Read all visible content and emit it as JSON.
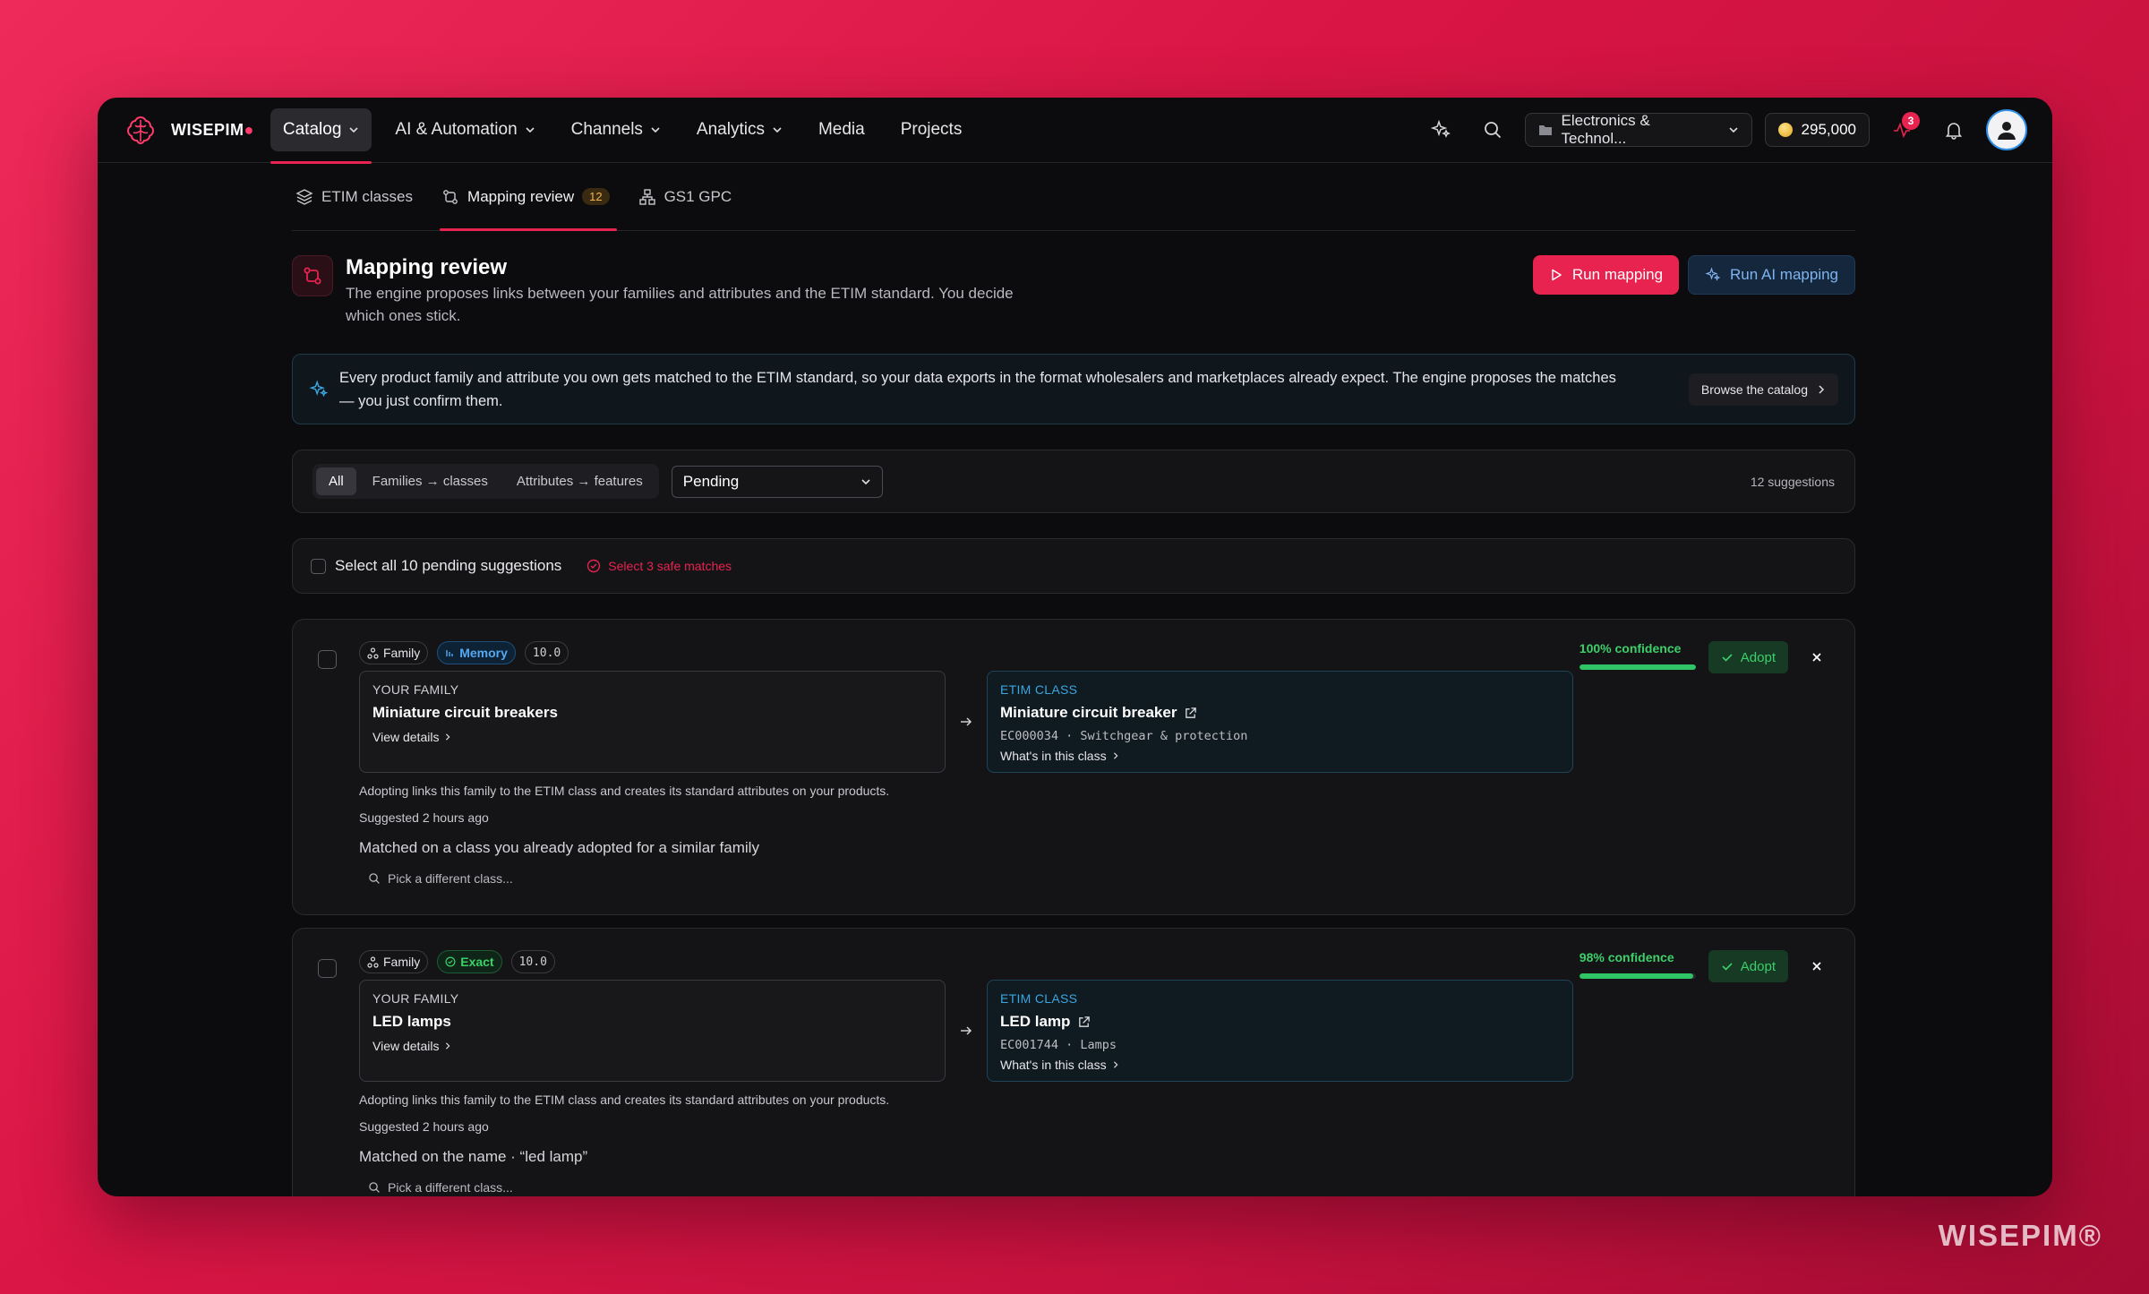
{
  "brand": {
    "name": "WISEPIM",
    "footer": "WISEPIM®"
  },
  "nav": {
    "items": [
      {
        "label": "Catalog"
      },
      {
        "label": "AI & Automation"
      },
      {
        "label": "Channels"
      },
      {
        "label": "Analytics"
      },
      {
        "label": "Media"
      },
      {
        "label": "Projects"
      }
    ],
    "workspace": "Electronics & Technol...",
    "credits": "295,000",
    "notification_count": "3"
  },
  "tabs": [
    {
      "label": "ETIM classes"
    },
    {
      "label": "Mapping review",
      "count": "12"
    },
    {
      "label": "GS1 GPC"
    }
  ],
  "header": {
    "title": "Mapping review",
    "description": "The engine proposes links between your families and attributes and the ETIM standard. You decide which ones stick.",
    "run_mapping": "Run mapping",
    "run_ai_mapping": "Run AI mapping"
  },
  "banner": {
    "text": "Every product family and attribute you own gets matched to the ETIM standard, so your data exports in the format wholesalers and marketplaces already expect. The engine proposes the matches — you just confirm them.",
    "button": "Browse the catalog"
  },
  "filters": {
    "segments": [
      "All",
      "Families → classes",
      "Attributes → features"
    ],
    "status_select": "Pending",
    "count": "12 suggestions"
  },
  "select_all": {
    "label": "Select all 10 pending suggestions",
    "safe": "Select 3 safe matches"
  },
  "cards": [
    {
      "type": "Family",
      "source_chip": "Memory",
      "score": "10.0",
      "family_label": "YOUR FAMILY",
      "family_name": "Miniature circuit breakers",
      "view_details": "View details",
      "etim_label": "ETIM CLASS",
      "etim_name": "Miniature circuit breaker",
      "etim_code": "EC000034 · Switchgear & protection",
      "whats_in": "What's in this class",
      "note": "Adopting links this family to the ETIM class and creates its standard attributes on your products.",
      "suggested": "Suggested 2 hours ago",
      "reason": "Matched on a class you already adopted for a similar family",
      "pick": "Pick a different class...",
      "confidence": "100% confidence",
      "confidence_value": 100,
      "adopt": "Adopt"
    },
    {
      "type": "Family",
      "source_chip": "Exact",
      "score": "10.0",
      "family_label": "YOUR FAMILY",
      "family_name": "LED lamps",
      "view_details": "View details",
      "etim_label": "ETIM CLASS",
      "etim_name": "LED lamp",
      "etim_code": "EC001744 · Lamps",
      "whats_in": "What's in this class",
      "note": "Adopting links this family to the ETIM class and creates its standard attributes on your products.",
      "suggested": "Suggested 2 hours ago",
      "reason": "Matched on the name · “led lamp”",
      "pick": "Pick a different class...",
      "confidence": "98% confidence",
      "confidence_value": 98,
      "adopt": "Adopt"
    }
  ]
}
